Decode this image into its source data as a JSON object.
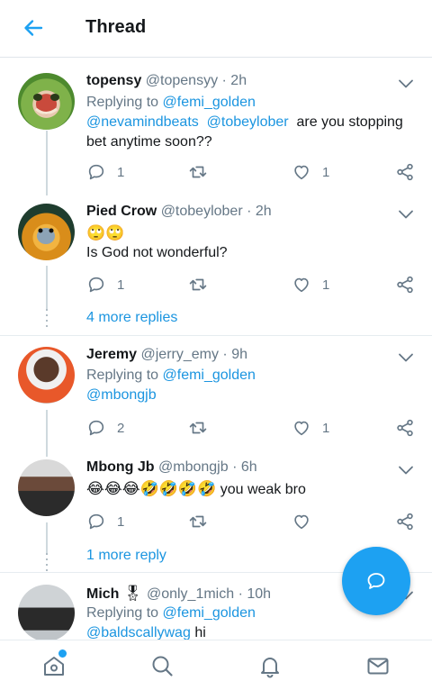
{
  "header": {
    "title": "Thread"
  },
  "colors": {
    "accent": "#1da1f2",
    "link": "#1b95e0",
    "secondary_text": "#657786"
  },
  "tweets": [
    {
      "name": "topensy",
      "handle": "@topensyy",
      "time": "2h",
      "replying_label": "Replying to",
      "replying_to": "@femi_golden",
      "mention1": "@nevamindbeats",
      "mention2": "@tobeylober",
      "text_line1": "are you stopping",
      "text_line2": "bet anytime soon??",
      "replies": "1",
      "retweets": "",
      "likes": "1"
    },
    {
      "name": "Pied Crow",
      "handle": "@tobeylober",
      "time": "2h",
      "emojis": "🙄🙄",
      "text": "Is God not wonderful?",
      "replies": "1",
      "retweets": "",
      "likes": "1",
      "more_replies": "4 more replies"
    },
    {
      "name": "Jeremy",
      "handle": "@jerry_emy",
      "time": "9h",
      "replying_label": "Replying to",
      "replying_to": "@femi_golden",
      "mention1": "@mbongjb",
      "replies": "2",
      "retweets": "",
      "likes": "1"
    },
    {
      "name": "Mbong Jb",
      "handle": "@mbongjb",
      "time": "6h",
      "emojis": "😂😂😂🤣🤣🤣🤣",
      "text": "you weak bro",
      "replies": "1",
      "retweets": "",
      "likes": "",
      "more_replies": "1 more reply"
    },
    {
      "name": "Mich",
      "badge": "🎖",
      "handle": "@only_1mich",
      "time": "10h",
      "replying_label": "Replying to",
      "replying_to": "@femi_golden",
      "mention1": "@baldscallywag",
      "text": "hi"
    }
  ],
  "sep": " · ",
  "icons": {
    "back": "arrow-left-icon",
    "chevron": "chevron-down-icon",
    "reply": "reply-icon",
    "retweet": "retweet-icon",
    "like": "heart-icon",
    "share": "share-icon",
    "fab": "compose-message-icon",
    "home": "home-icon",
    "search": "search-icon",
    "notifications": "bell-icon",
    "messages": "envelope-icon"
  }
}
